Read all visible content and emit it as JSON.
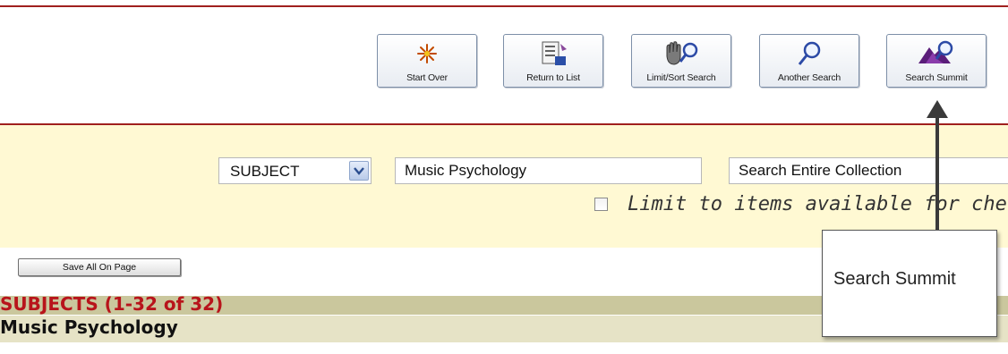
{
  "toolbar": {
    "buttons": [
      {
        "label": "Start Over",
        "icon": "start-over-icon"
      },
      {
        "label": "Return to List",
        "icon": "return-to-list-icon"
      },
      {
        "label": "Limit/Sort Search",
        "icon": "hand-magnifier-icon"
      },
      {
        "label": "Another Search",
        "icon": "magnifier-icon"
      },
      {
        "label": "Search Summit",
        "icon": "mountain-magnifier-icon"
      }
    ]
  },
  "search": {
    "field_select": "SUBJECT",
    "query": "Music Psychology",
    "scope": "Search Entire Collection",
    "limit_label": "Limit to items available for che"
  },
  "results": {
    "save_all_label": "Save All On Page",
    "heading": "SUBJECTS (1-32 of 32)",
    "subheading": "Music Psychology"
  },
  "callout": {
    "text": "Search Summit"
  },
  "colors": {
    "rule": "#a0201e",
    "search_band": "#fff9d3",
    "heading_bar": "#cac79d",
    "heading_text": "#b8141b",
    "subheading_bar": "#e6e3c6"
  }
}
